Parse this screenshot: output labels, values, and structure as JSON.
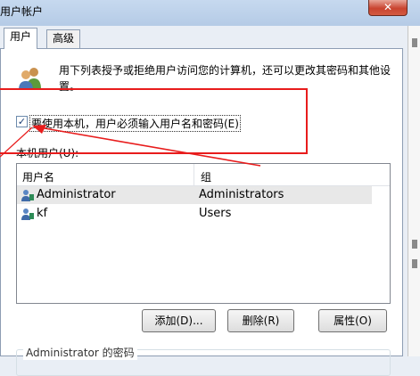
{
  "window": {
    "title": "用户帐户",
    "close_glyph": "✕"
  },
  "tabs": [
    {
      "label": "用户",
      "active": true
    },
    {
      "label": "高级",
      "active": false
    }
  ],
  "intro": {
    "text": "用下列表授予或拒绝用户访问您的计算机，还可以更改其密码和其他设置。"
  },
  "require_login": {
    "label": "要使用本机，用户必须输入用户名和密码(E)",
    "checked": true,
    "check_glyph": "✓"
  },
  "users_section": {
    "label": "本机用户(U):"
  },
  "table": {
    "columns": [
      "用户名",
      "组"
    ],
    "rows": [
      {
        "name": "Administrator",
        "group": "Administrators",
        "selected": true
      },
      {
        "name": "kf",
        "group": "Users",
        "selected": false
      }
    ]
  },
  "buttons": {
    "add": "添加(D)...",
    "remove": "删除(R)",
    "properties": "属性(O)"
  },
  "password_group": {
    "label": "Administrator 的密码"
  },
  "colors": {
    "annotation": "#e81c1c",
    "title_bar": "#c6d9ef",
    "panel_bg": "#ffffff"
  }
}
